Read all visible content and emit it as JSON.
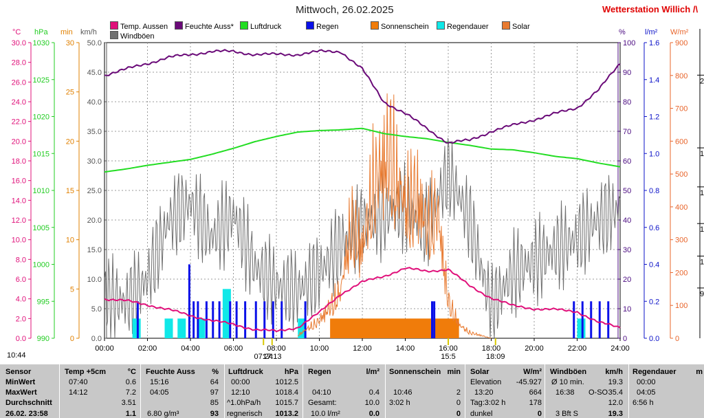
{
  "title": "Mittwoch, 26.02.2025",
  "station": "Wetterstation Willich",
  "station_suffix": "/\\",
  "colors": {
    "temp": "#e0107a",
    "humidity": "#6a0a78",
    "pressure": "#22dd22",
    "rain": "#0a10e8",
    "sunshine": "#f07c0a",
    "raindur": "#10e8e8",
    "solar": "#e87a30",
    "gust": "#707070",
    "axis_temp": "#e0107a",
    "axis_hpa": "#22cc22",
    "axis_min": "#e08000",
    "axis_kmh": "#555555",
    "axis_pct": "#4a0a80",
    "axis_lm2": "#0a10c8",
    "axis_wm2": "#e8642a"
  },
  "legend": [
    {
      "label": "Temp. Aussen",
      "color": "#e0107a"
    },
    {
      "label": "Feuchte Auss*",
      "color": "#6a0a78"
    },
    {
      "label": "Luftdruck",
      "color": "#22dd22"
    },
    {
      "label": "Regen",
      "color": "#0a10e8"
    },
    {
      "label": "Sonnenschein",
      "color": "#f07c0a"
    },
    {
      "label": "Regendauer",
      "color": "#10e8e8"
    },
    {
      "label": "Solar",
      "color": "#e87a30"
    },
    {
      "label": "Windböen",
      "color": "#707070"
    }
  ],
  "units": {
    "temp": "°C",
    "hpa": "hPa",
    "min": "min",
    "kmh": "km/h",
    "pct": "%",
    "lm2": "l/m²",
    "wm2": "W/m²"
  },
  "chart_data": {
    "type": "line",
    "x_ticks": [
      "00:00",
      "02:00",
      "04:00",
      "06:00",
      "08:00",
      "10:00",
      "12:00",
      "14:00",
      "16:00",
      "18:00",
      "20:00",
      "22:00",
      "24:00"
    ],
    "axes": {
      "temp": {
        "ticks": [
          "30.0",
          "28.0",
          "26.0",
          "24.0",
          "22.0",
          "20.0",
          "18.0",
          "16.0",
          "14.0",
          "12.0",
          "10.0",
          "8.0",
          "6.0",
          "4.0",
          "2.0",
          "0.0"
        ],
        "range": [
          0,
          30
        ]
      },
      "hpa": {
        "ticks": [
          "1030",
          "1025",
          "1020",
          "1015",
          "1010",
          "1005",
          "1000",
          "995",
          "990"
        ],
        "range": [
          990,
          1030
        ]
      },
      "min": {
        "ticks": [
          "30",
          "25",
          "20",
          "15",
          "10",
          "5",
          "0"
        ],
        "range": [
          0,
          30
        ]
      },
      "kmh": {
        "ticks": [
          "50.0",
          "45.0",
          "40.0",
          "35.0",
          "30.0",
          "25.0",
          "20.0",
          "15.0",
          "10.0",
          "5.0",
          "0.0"
        ],
        "range": [
          0,
          50
        ]
      },
      "pct": {
        "ticks": [
          "100",
          "90",
          "80",
          "70",
          "60",
          "50",
          "40",
          "30",
          "20",
          "10",
          "0"
        ],
        "range": [
          0,
          100
        ]
      },
      "lm2": {
        "ticks": [
          "1.6",
          "1.4",
          "1.2",
          "1.0",
          "0.8",
          "0.6",
          "0.4",
          "0.2",
          "0.0"
        ],
        "range": [
          0,
          1.6
        ]
      },
      "wm2": {
        "ticks": [
          "900",
          "800",
          "700",
          "600",
          "500",
          "400",
          "300",
          "200",
          "100",
          "0"
        ],
        "range": [
          0,
          900
        ]
      }
    },
    "right_edge_ticks": [
      {
        "label": "2",
        "axis": "kmh",
        "value": 44.5
      },
      {
        "label": "1",
        "axis": "kmh",
        "value": 32.2
      },
      {
        "label": "1",
        "axis": "kmh",
        "value": 25.6
      },
      {
        "label": "1",
        "axis": "kmh",
        "value": 19.4
      },
      {
        "label": "1",
        "axis": "kmh",
        "value": 13.9
      },
      {
        "label": "9",
        "axis": "kmh",
        "value": 8.5
      }
    ],
    "series": [
      {
        "name": "Temp. Aussen",
        "axis": "temp",
        "color": "#e0107a",
        "x": [
          0,
          1,
          2,
          3,
          4,
          5,
          6,
          7,
          8,
          9,
          10,
          11,
          12,
          13,
          14,
          15,
          16,
          17,
          18,
          19,
          20,
          21,
          22,
          23,
          24
        ],
        "y": [
          4.0,
          3.8,
          3.4,
          2.9,
          2.3,
          1.8,
          1.4,
          0.9,
          0.7,
          1.1,
          2.6,
          4.5,
          5.7,
          6.3,
          7.1,
          6.8,
          7.0,
          5.3,
          4.1,
          3.3,
          3.0,
          2.9,
          2.7,
          1.6,
          1.1
        ]
      },
      {
        "name": "Feuchte Auss*",
        "axis": "pct",
        "color": "#6a0a78",
        "x": [
          0,
          1,
          2,
          3,
          4,
          5,
          6,
          7,
          8,
          9,
          10,
          11,
          12,
          13,
          14,
          15,
          16,
          17,
          18,
          19,
          20,
          21,
          22,
          23,
          24
        ],
        "y": [
          89,
          91,
          93,
          95,
          96,
          97,
          97,
          96,
          96,
          96,
          97,
          97,
          91,
          80,
          76,
          71,
          66,
          67,
          70,
          72,
          74,
          76,
          78,
          84,
          93
        ]
      },
      {
        "name": "Luftdruck",
        "axis": "hpa",
        "color": "#22dd22",
        "x": [
          0,
          1,
          2,
          3,
          4,
          5,
          6,
          7,
          8,
          9,
          10,
          11,
          12,
          13,
          14,
          15,
          16,
          17,
          18,
          19,
          20,
          21,
          22,
          23,
          24
        ],
        "y": [
          1012.5,
          1012.9,
          1013.4,
          1013.8,
          1014.2,
          1014.9,
          1015.7,
          1016.6,
          1017.3,
          1017.9,
          1018.1,
          1018.2,
          1018.4,
          1017.7,
          1017.3,
          1017.0,
          1016.5,
          1016.1,
          1015.6,
          1015.5,
          1015.1,
          1014.6,
          1014.3,
          1013.7,
          1013.2
        ]
      },
      {
        "name": "Regen",
        "axis": "lm2",
        "color": "#0a10e8",
        "x": [
          1.5,
          3.9,
          4.1,
          4.3,
          4.7,
          5.0,
          5.3,
          5.8,
          6.1,
          6.5,
          7.0,
          7.4,
          7.8,
          8.2,
          9.3,
          15.2,
          15.3,
          21.8,
          22.2,
          22.6,
          23.0,
          23.4
        ],
        "y": [
          0.2,
          0.4,
          0.2,
          0.2,
          0.2,
          0.2,
          0.2,
          0.2,
          0.2,
          0.2,
          0.2,
          0.2,
          0.2,
          0.2,
          0.2,
          0.2,
          0.2,
          0.2,
          0.2,
          0.2,
          0.2,
          0.2
        ]
      },
      {
        "name": "Sonnenschein",
        "axis": "min",
        "x": [
          11.0,
          12.0,
          13.0,
          14.0,
          15.0,
          16.0
        ],
        "y": [
          2,
          2,
          2,
          2,
          2,
          2
        ]
      },
      {
        "name": "Regendauer",
        "axis": "min",
        "x": [
          1.3,
          2.8,
          3.4,
          4.3,
          5.5,
          9.0,
          22.0
        ],
        "y": [
          2,
          2,
          2,
          2,
          5,
          2,
          2
        ]
      },
      {
        "name": "Solar",
        "axis": "wm2",
        "color": "#e87a30",
        "x": [
          9.0,
          10.0,
          11.0,
          11.5,
          12.0,
          12.5,
          13.0,
          13.3,
          13.6,
          14.0,
          14.5,
          15.0,
          15.5,
          16.0,
          16.5,
          17.0,
          18.0
        ],
        "y": [
          10,
          60,
          160,
          400,
          300,
          520,
          600,
          664,
          540,
          450,
          500,
          380,
          430,
          130,
          45,
          20,
          0
        ]
      },
      {
        "name": "Windböen",
        "axis": "kmh",
        "color": "#707070",
        "x": [
          0,
          1,
          2,
          3,
          4,
          5,
          6,
          7,
          8,
          9,
          10,
          11,
          12,
          13,
          14,
          15,
          16,
          17,
          18,
          19,
          20,
          21,
          22,
          23,
          24
        ],
        "y": [
          7,
          6,
          10,
          20,
          23,
          17,
          21,
          12,
          9,
          8,
          11,
          16,
          19,
          21,
          22,
          19,
          28,
          20,
          5,
          11,
          13,
          15,
          17,
          20,
          22
        ]
      }
    ],
    "markers": [
      {
        "label": "07:24",
        "x_time": 7.4
      },
      {
        "label": "17:13",
        "x_time": 7.8
      },
      {
        "label": "15:5",
        "x_time": 16.0
      },
      {
        "label": "18:09",
        "x_time": 18.2
      }
    ]
  },
  "clock": "10:44",
  "table": {
    "rows_labels": [
      "Sensor",
      "MinWert",
      "MaxWert",
      "Durchschnitt",
      "26.02. 23:58"
    ],
    "temp": {
      "header": "Temp +5cm",
      "unit": "°C",
      "min_time": "07:40",
      "min": "0.6",
      "max_time": "14:12",
      "max": "7.2",
      "avg": "3.51",
      "cur": "1.1"
    },
    "hum": {
      "header": "Feuchte Auss",
      "unit": "%",
      "min_time": "15:16",
      "min": "64",
      "max_time": "04:05",
      "max": "97",
      "avg": "85",
      "cur_extra": "6.80 g/m³",
      "cur": "93"
    },
    "press": {
      "header": "Luftdruck",
      "unit": "hPa",
      "min_time": "00:00",
      "min": "1012.5",
      "max_time": "12:10",
      "max": "1018.4",
      "avg_label": "^1.0hPa/h",
      "avg": "1015.7",
      "cur_extra": "regnerisch",
      "cur": "1013.2"
    },
    "rain": {
      "header": "Regen",
      "unit": "l/m²",
      "max_time": "04:10",
      "max": "0.4",
      "avg_label": "Gesamt:",
      "avg": "10.0",
      "cur_extra": "10.0 l/m²",
      "cur": "0.0"
    },
    "sun": {
      "header": "Sonnenschein",
      "unit": "min",
      "max_time": "10:46",
      "max": "2",
      "avg_label": "3:02 h",
      "avg": "0",
      "cur": "0"
    },
    "solar": {
      "header": "Solar",
      "unit": "W/m²",
      "min_label": "Elevation",
      "min": "-45.927",
      "max_time": "13:20",
      "max": "664",
      "avg_label": "Tag:3:02 h",
      "avg": "178",
      "cur_extra": "dunkel",
      "cur": "0"
    },
    "wind": {
      "header": "Windböen",
      "unit": "km/h",
      "min_label": "Ø 10 min.",
      "min": "19.3",
      "max_time": "16:38",
      "max_dir": "O-SO",
      "max": "35.4",
      "avg": "12.0",
      "cur_extra": "3 Bft S",
      "cur": "19.3"
    },
    "raindur": {
      "header": "Regendauer",
      "unit": "m",
      "min_time": "00:00",
      "max_time": "04:05",
      "avg": "6:56 h"
    }
  }
}
